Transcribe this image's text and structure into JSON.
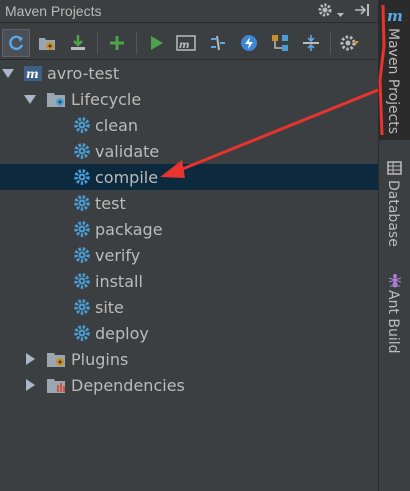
{
  "panel": {
    "title": "Maven Projects"
  },
  "toolbar": {
    "buttons": [
      {
        "icon": "reimport-icon",
        "label": "Reimport All Maven Projects"
      },
      {
        "icon": "generate-sources-icon",
        "label": "Generate Sources"
      },
      {
        "icon": "download-icon",
        "label": "Download Sources"
      },
      {
        "icon": "add-icon",
        "label": "Add Maven Projects"
      },
      {
        "icon": "run-icon",
        "label": "Run Maven Build"
      },
      {
        "icon": "maven-goal-icon",
        "label": "Execute Maven Goal"
      },
      {
        "icon": "toggle-offline-icon",
        "label": "Toggle Offline Mode"
      },
      {
        "icon": "skip-tests-icon",
        "label": "Toggle Skip Tests Mode"
      },
      {
        "icon": "show-dependencies-icon",
        "label": "Show Dependencies"
      },
      {
        "icon": "collapse-all-icon",
        "label": "Collapse All"
      },
      {
        "icon": "settings-icon",
        "label": "Maven Settings"
      }
    ]
  },
  "tree": {
    "project": "avro-test",
    "lifecycle_label": "Lifecycle",
    "goals": [
      "clean",
      "validate",
      "compile",
      "test",
      "package",
      "verify",
      "install",
      "site",
      "deploy"
    ],
    "selected_goal": "compile",
    "plugins_label": "Plugins",
    "dependencies_label": "Dependencies"
  },
  "side_tabs": {
    "maven": "Maven Projects",
    "database": "Database",
    "ant": "Ant Build"
  },
  "colors": {
    "background": "#3c3f41",
    "selection": "#0d293e",
    "gear": "#4a9ed8",
    "annotation": "#e8332e"
  }
}
